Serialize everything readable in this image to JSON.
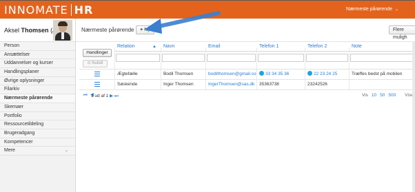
{
  "app": {
    "logo_left": "INNOMATE",
    "logo_right": "HR",
    "top_user_menu": "Nærmeste pårørende",
    "top_user_chevron": "⌄"
  },
  "profile": {
    "first_name": "Aksel",
    "last_name": "Thomsen",
    "suffix": "(AT)"
  },
  "sidebar": {
    "items": [
      {
        "label": "Person"
      },
      {
        "label": "Ansættelser"
      },
      {
        "label": "Uddannelser og kurser"
      },
      {
        "label": "Handlingsplaner"
      },
      {
        "label": "Øvrige oplysninger"
      },
      {
        "label": "Filarkiv"
      },
      {
        "label": "Nærmeste pårørende",
        "active": true
      },
      {
        "label": "Skemaer"
      },
      {
        "label": "Portfolio"
      },
      {
        "label": "Ressourcetildeling"
      },
      {
        "label": "Brugeradgang"
      },
      {
        "label": "Kompetencer"
      },
      {
        "label": "Mere",
        "chevron": "⌄"
      }
    ]
  },
  "header": {
    "title": "Nærmeste pårørende",
    "new_button": "Ny",
    "more_button": "Flere muligh"
  },
  "grid": {
    "actions_button": "Handlinger",
    "reset_button": "Nulstil",
    "columns": [
      "Relation",
      "Navn",
      "Email",
      "Telefon 1",
      "Telefon 2",
      "Note"
    ],
    "sort_indicator": "▲",
    "rows": [
      {
        "relation": "Ægtefælle",
        "navn": "Bodil Thomsen",
        "email": "bodilthomsen@gmail.com",
        "telefon1": "33 34 35 36",
        "telefon2": "22 23 24 25",
        "note": "Træffes bedst på mobilen"
      },
      {
        "relation": "Søskende",
        "navn": "Inger Thomsen",
        "email": "IngerThomsen@sas.dk",
        "telefon1": "35363738",
        "telefon2": "23242526",
        "note": ""
      }
    ],
    "pager": {
      "nav_icons": "⏮ ◀",
      "page_text": "1 ud af 1",
      "nav_icons_after": "▶ ⏭",
      "vis_label": "Vis",
      "options": [
        "10",
        "50",
        "500"
      ],
      "viser_label": "Viser"
    }
  },
  "colors": {
    "accent": "#e3631d",
    "link": "#2a7bd1",
    "arrow": "#3a7fd0"
  }
}
